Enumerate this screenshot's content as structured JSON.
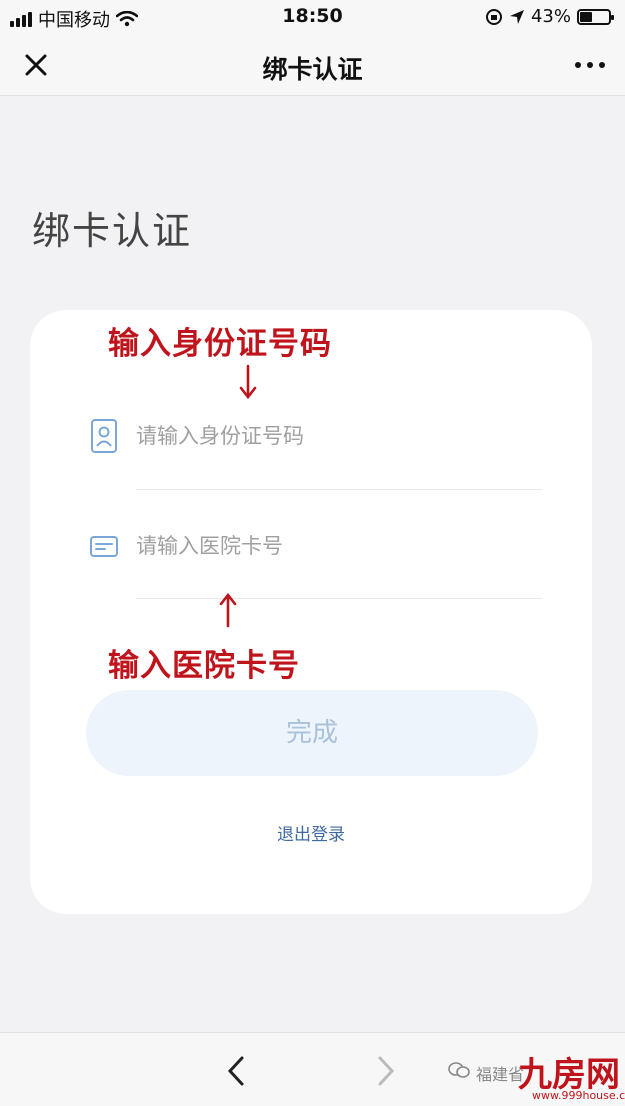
{
  "status_bar": {
    "carrier": "中国移动",
    "time": "18:50",
    "battery_percent": "43%",
    "battery_level": 0.43
  },
  "nav": {
    "title": "绑卡认证",
    "close_icon": "close-icon",
    "more_icon": "more-icon"
  },
  "page": {
    "heading": "绑卡认证"
  },
  "form": {
    "annotation_id": "输入身份证号码",
    "annotation_card": "输入医院卡号",
    "id_field": {
      "placeholder": "请输入身份证号码",
      "value": "",
      "icon": "id-card-icon"
    },
    "card_field": {
      "placeholder": "请输入医院卡号",
      "value": "",
      "icon": "card-icon"
    },
    "done_label": "完成",
    "logout_label": "退出登录"
  },
  "bottom_bar": {
    "back_icon": "chevron-left-icon",
    "forward_icon": "chevron-right-icon",
    "watermark_text": "福建省",
    "watermark_logo": "九房网",
    "watermark_url": "www.999house.com"
  },
  "colors": {
    "annotation": "#c0141c",
    "button_bg": "#eef4fb",
    "button_text": "#a9c1db",
    "link": "#3f6aa1"
  }
}
